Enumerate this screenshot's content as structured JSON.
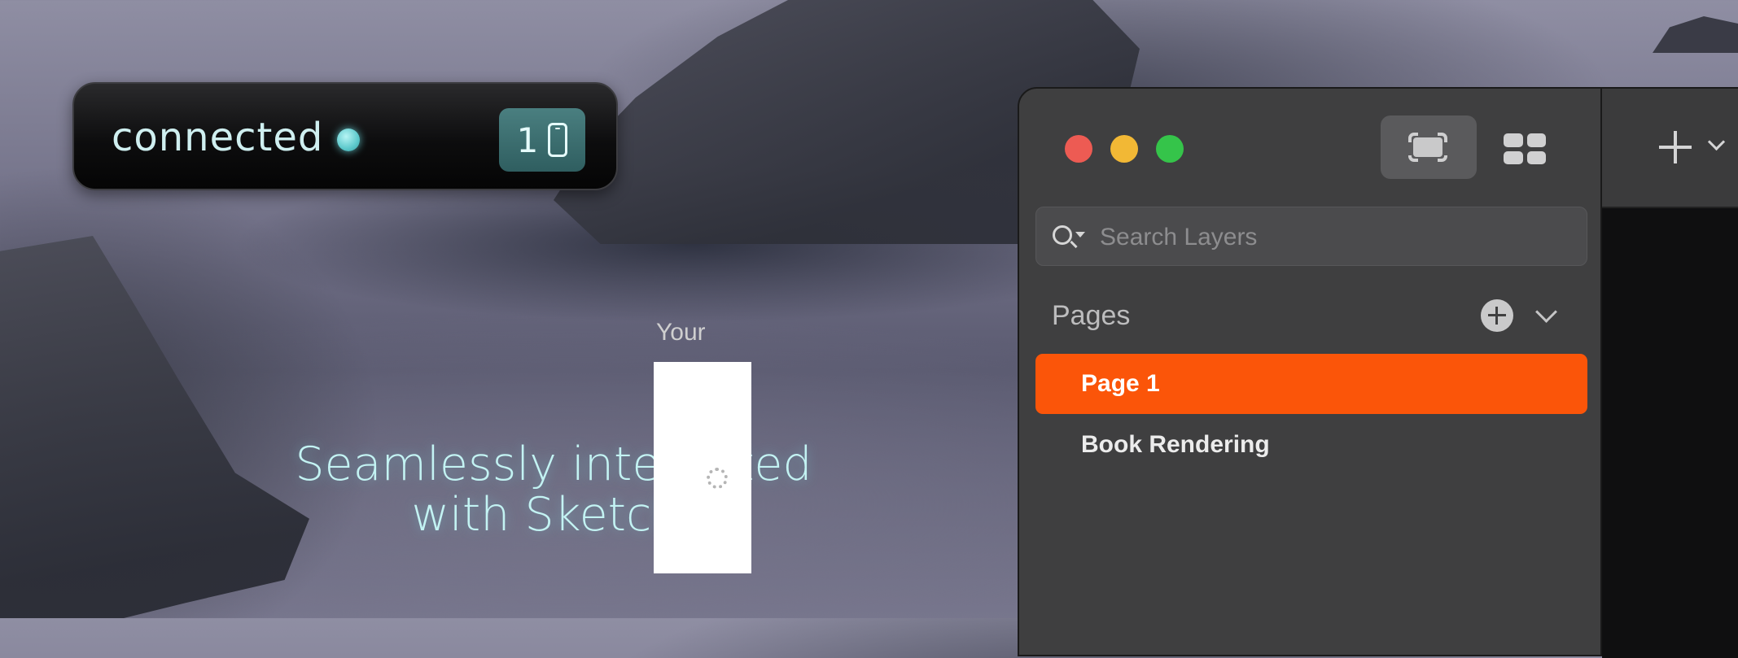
{
  "status": {
    "label": "connected",
    "device_count": "1",
    "device_icon": "phone-icon",
    "indicator_color": "#5dc9cc"
  },
  "tagline": {
    "line1": "Seamlessly integrated",
    "line2": "with Sketch."
  },
  "window": {
    "search": {
      "placeholder": "Search Layers",
      "value": ""
    },
    "pages": {
      "header": "Pages",
      "items": [
        {
          "label": "Page 1",
          "selected": true
        },
        {
          "label": "Book Rendering",
          "selected": false
        }
      ],
      "selected_color": "#fb5509"
    },
    "canvas": {
      "label": "Yours"
    }
  }
}
